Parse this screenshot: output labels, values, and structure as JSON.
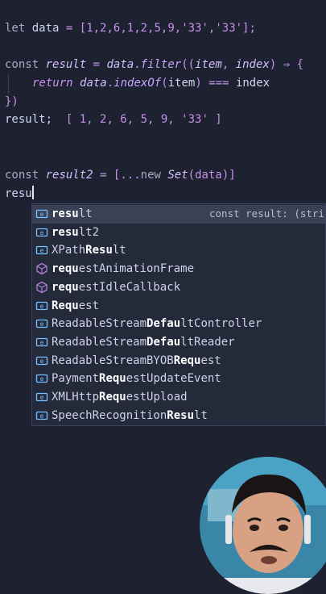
{
  "code": {
    "line1": {
      "kw": "let",
      "name": "data",
      "eq": "=",
      "array": "[1,2,6,1,2,5,9,'33','33'];"
    },
    "line2": {
      "kw": "const",
      "name": "result",
      "eq": "=",
      "obj": "data",
      "method": "filter",
      "open": "((",
      "p1": "item",
      "comma": ",",
      "p2": "index",
      "close": ")",
      "arrow": "⇒",
      "brace": "{"
    },
    "line3": {
      "ret": "return",
      "obj": "data",
      "method": "indexOf",
      "open": "(",
      "arg": "item",
      "close": ")",
      "op": "===",
      "rhs": "index"
    },
    "line4": {
      "text": "})"
    },
    "line5": {
      "label": "result;",
      "output": "[ 1, 2, 6, 5, 9, '33' ]"
    },
    "line6": {
      "kw": "const",
      "name": "result2",
      "eq": "=",
      "open": "[...",
      "new": "new",
      "cls": "Set",
      "arg": "(data)",
      "close": "]"
    },
    "line7": {
      "typed": "resu"
    }
  },
  "suggestions": [
    {
      "icon": "variable-icon",
      "match": "resu",
      "rest": "lt",
      "detail": "const result: (string",
      "selected": true
    },
    {
      "icon": "variable-icon",
      "match": "resu",
      "rest": "lt2",
      "detail": ""
    },
    {
      "icon": "variable-icon",
      "pre": "XPath",
      "match": "Resu",
      "rest": "lt",
      "detail": ""
    },
    {
      "icon": "method-icon",
      "match": "requ",
      "rest": "estAnimationFrame",
      "detail": ""
    },
    {
      "icon": "method-icon",
      "match": "requ",
      "rest": "estIdleCallback",
      "detail": ""
    },
    {
      "icon": "variable-icon",
      "match": "Requ",
      "rest": "est",
      "detail": ""
    },
    {
      "icon": "variable-icon",
      "pre": "ReadableStream",
      "match": "Defau",
      "rest": "ltController",
      "detail": ""
    },
    {
      "icon": "variable-icon",
      "pre": "ReadableStream",
      "match": "Defau",
      "rest": "ltReader",
      "detail": ""
    },
    {
      "icon": "variable-icon",
      "pre": "ReadableStreamBYOB",
      "match": "Requ",
      "rest": "est",
      "detail": ""
    },
    {
      "icon": "variable-icon",
      "pre": "Payment",
      "match": "Requ",
      "rest": "estUpdateEvent",
      "detail": ""
    },
    {
      "icon": "variable-icon",
      "pre": "XMLHttp",
      "match": "Requ",
      "rest": "estUpload",
      "detail": ""
    },
    {
      "icon": "variable-icon",
      "pre": "SpeechRecognition",
      "match": "Resu",
      "rest": "lt",
      "detail": ""
    }
  ]
}
